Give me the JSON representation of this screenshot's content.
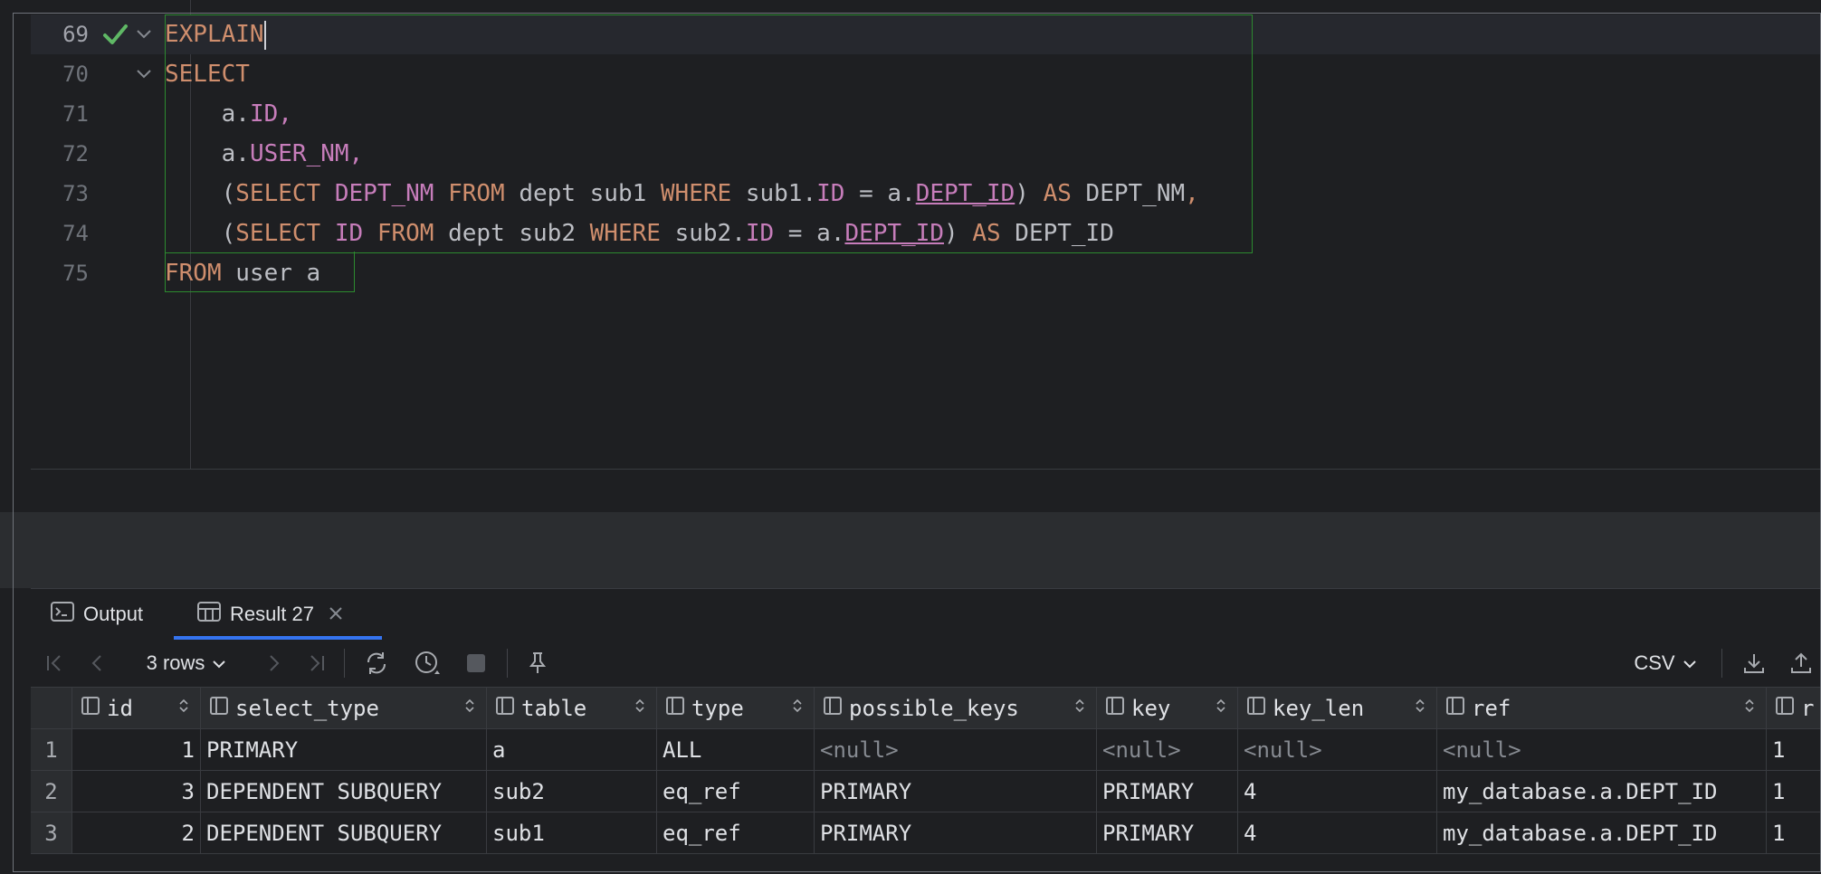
{
  "editor": {
    "current_line": "69",
    "lines": [
      {
        "num": "69"
      },
      {
        "num": "70"
      },
      {
        "num": "71"
      },
      {
        "num": "72"
      },
      {
        "num": "73"
      },
      {
        "num": "74"
      },
      {
        "num": "75"
      }
    ],
    "tokens": {
      "l69": [
        "EXPLAIN"
      ],
      "l70": [
        "SELECT"
      ],
      "l71": [
        "a.",
        "ID",
        ","
      ],
      "l72": [
        "a.",
        "USER_NM",
        ","
      ],
      "l73": [
        "(",
        "SELECT",
        " ",
        "DEPT_NM",
        " ",
        "FROM",
        " dept sub1 ",
        "WHERE",
        " sub1.",
        "ID",
        " = a.",
        "DEPT_ID",
        ") ",
        "AS",
        " DEPT_NM",
        ","
      ],
      "l74": [
        "(",
        "SELECT",
        " ",
        "ID",
        " ",
        "FROM",
        " dept sub2 ",
        "WHERE",
        " sub2.",
        "ID",
        " = a.",
        "DEPT_ID",
        ") ",
        "AS",
        " DEPT_ID"
      ],
      "l75": [
        "FROM",
        " user a"
      ]
    }
  },
  "panel": {
    "tabs": [
      {
        "label": "Output",
        "icon": "terminal-icon"
      },
      {
        "label": "Result 27",
        "icon": "table-icon"
      }
    ],
    "rows_label": "3 rows",
    "export_format": "CSV"
  },
  "colors": {
    "keyword": "#cf8e6d",
    "column": "#c77dbb",
    "selection_border": "#2c8a2f",
    "accent": "#3574f0"
  },
  "table": {
    "columns": [
      "id",
      "select_type",
      "table",
      "type",
      "possible_keys",
      "key",
      "key_len",
      "ref",
      "r"
    ],
    "rows": [
      {
        "n": "1",
        "id": "1",
        "select_type": "PRIMARY",
        "table": "a",
        "type": "ALL",
        "possible_keys": "<null>",
        "key": "<null>",
        "key_len": "<null>",
        "ref": "<null>",
        "rows": "1"
      },
      {
        "n": "2",
        "id": "3",
        "select_type": "DEPENDENT SUBQUERY",
        "table": "sub2",
        "type": "eq_ref",
        "possible_keys": "PRIMARY",
        "key": "PRIMARY",
        "key_len": "4",
        "ref": "my_database.a.DEPT_ID",
        "rows": "1"
      },
      {
        "n": "3",
        "id": "2",
        "select_type": "DEPENDENT SUBQUERY",
        "table": "sub1",
        "type": "eq_ref",
        "possible_keys": "PRIMARY",
        "key": "PRIMARY",
        "key_len": "4",
        "ref": "my_database.a.DEPT_ID",
        "rows": "1"
      }
    ]
  }
}
